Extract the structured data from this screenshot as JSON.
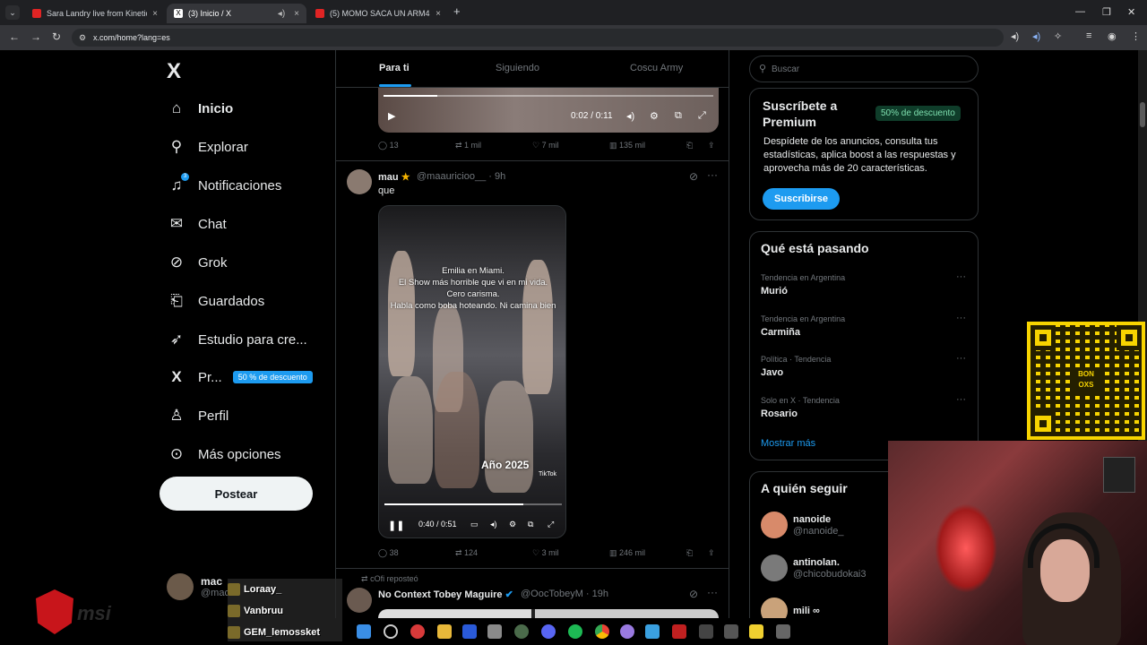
{
  "browser": {
    "tabs": [
      {
        "label": "Sara Landry live from Kinetic Fi",
        "close": "×",
        "active": false
      },
      {
        "label": "(3) Inicio / X",
        "close": "×",
        "active": true
      },
      {
        "label": "(5) MOMO SACA UN ARM4 Y E",
        "close": "×",
        "active": false
      }
    ],
    "new_tab": "+",
    "url": "x.com/home?lang=es"
  },
  "sidebar": {
    "logo": "X",
    "items": [
      {
        "label": "Inicio",
        "icon": "home-icon"
      },
      {
        "label": "Explorar",
        "icon": "search-icon"
      },
      {
        "label": "Notificaciones",
        "icon": "bell-icon",
        "badge": "3"
      },
      {
        "label": "Chat",
        "icon": "mail-icon"
      },
      {
        "label": "Grok",
        "icon": "grok-icon"
      },
      {
        "label": "Guardados",
        "icon": "bookmark-icon"
      },
      {
        "label": "Estudio para cre...",
        "icon": "rocket-icon"
      },
      {
        "label": "Pr...",
        "icon": "x-premium-icon",
        "badge": "50 % de descuento"
      },
      {
        "label": "Perfil",
        "icon": "person-icon"
      },
      {
        "label": "Más opciones",
        "icon": "more-circle-icon"
      }
    ],
    "post_button": "Postear",
    "account": {
      "name": "mac",
      "handle": "@mac"
    }
  },
  "timeline": {
    "tabs": [
      "Para ti",
      "Siguiendo",
      "Coscu Army"
    ],
    "tweet1": {
      "time": "0:02 / 0:11",
      "actions": {
        "replies": "13",
        "reposts": "1 mil",
        "likes": "7 mil",
        "views": "135 mil"
      }
    },
    "tweet2": {
      "name": "mau",
      "handle": "@maauricioo__",
      "time": "· 9h",
      "text": "que",
      "caption": [
        "Emilia en Miami.",
        "El Show más horrible que vi en mi vida.",
        "Cero carisma.",
        "Habla como boba hoteando. Ni camina bien"
      ],
      "year": "Año 2025",
      "tiktok": "TikTok",
      "video_time": "0:40 / 0:51",
      "actions": {
        "replies": "38",
        "reposts": "124",
        "likes": "3 mil",
        "views": "246 mil"
      }
    },
    "tweet3": {
      "repost": "cOfi reposteó",
      "name": "No Context Tobey Maguire",
      "handle": "@OocTobeyM",
      "time": "· 19h"
    }
  },
  "right": {
    "search_placeholder": "Buscar",
    "premium": {
      "title": "Suscríbete a Premium",
      "badge": "50% de descuento",
      "desc": "Despídete de los anuncios, consulta tus estadísticas, aplica boost a las respuestas y aprovecha más de 20 características.",
      "button": "Suscribirse"
    },
    "trends": {
      "title": "Qué está pasando",
      "items": [
        {
          "context": "Tendencia en Argentina",
          "name": "Murió"
        },
        {
          "context": "Tendencia en Argentina",
          "name": "Carmiña"
        },
        {
          "context": "Política · Tendencia",
          "name": "Javo"
        },
        {
          "context": "Solo en X · Tendencia",
          "name": "Rosario"
        }
      ],
      "more": "Mostrar más"
    },
    "follow": {
      "title": "A quién seguir",
      "items": [
        {
          "name": "nanoide",
          "handle": "@nanoide_",
          "color": "#d88a6a"
        },
        {
          "name": "antinolan.",
          "handle": "@chicobudokai3",
          "color": "#7a7a7a"
        },
        {
          "name": "mili ∞",
          "handle": "",
          "color": "#c9a27a"
        }
      ]
    }
  },
  "overlay": {
    "qr_label": "BON OXS",
    "chat": [
      "Loraay_",
      "Vanbruu",
      "GEM_lemossket"
    ],
    "brand": "msi"
  }
}
